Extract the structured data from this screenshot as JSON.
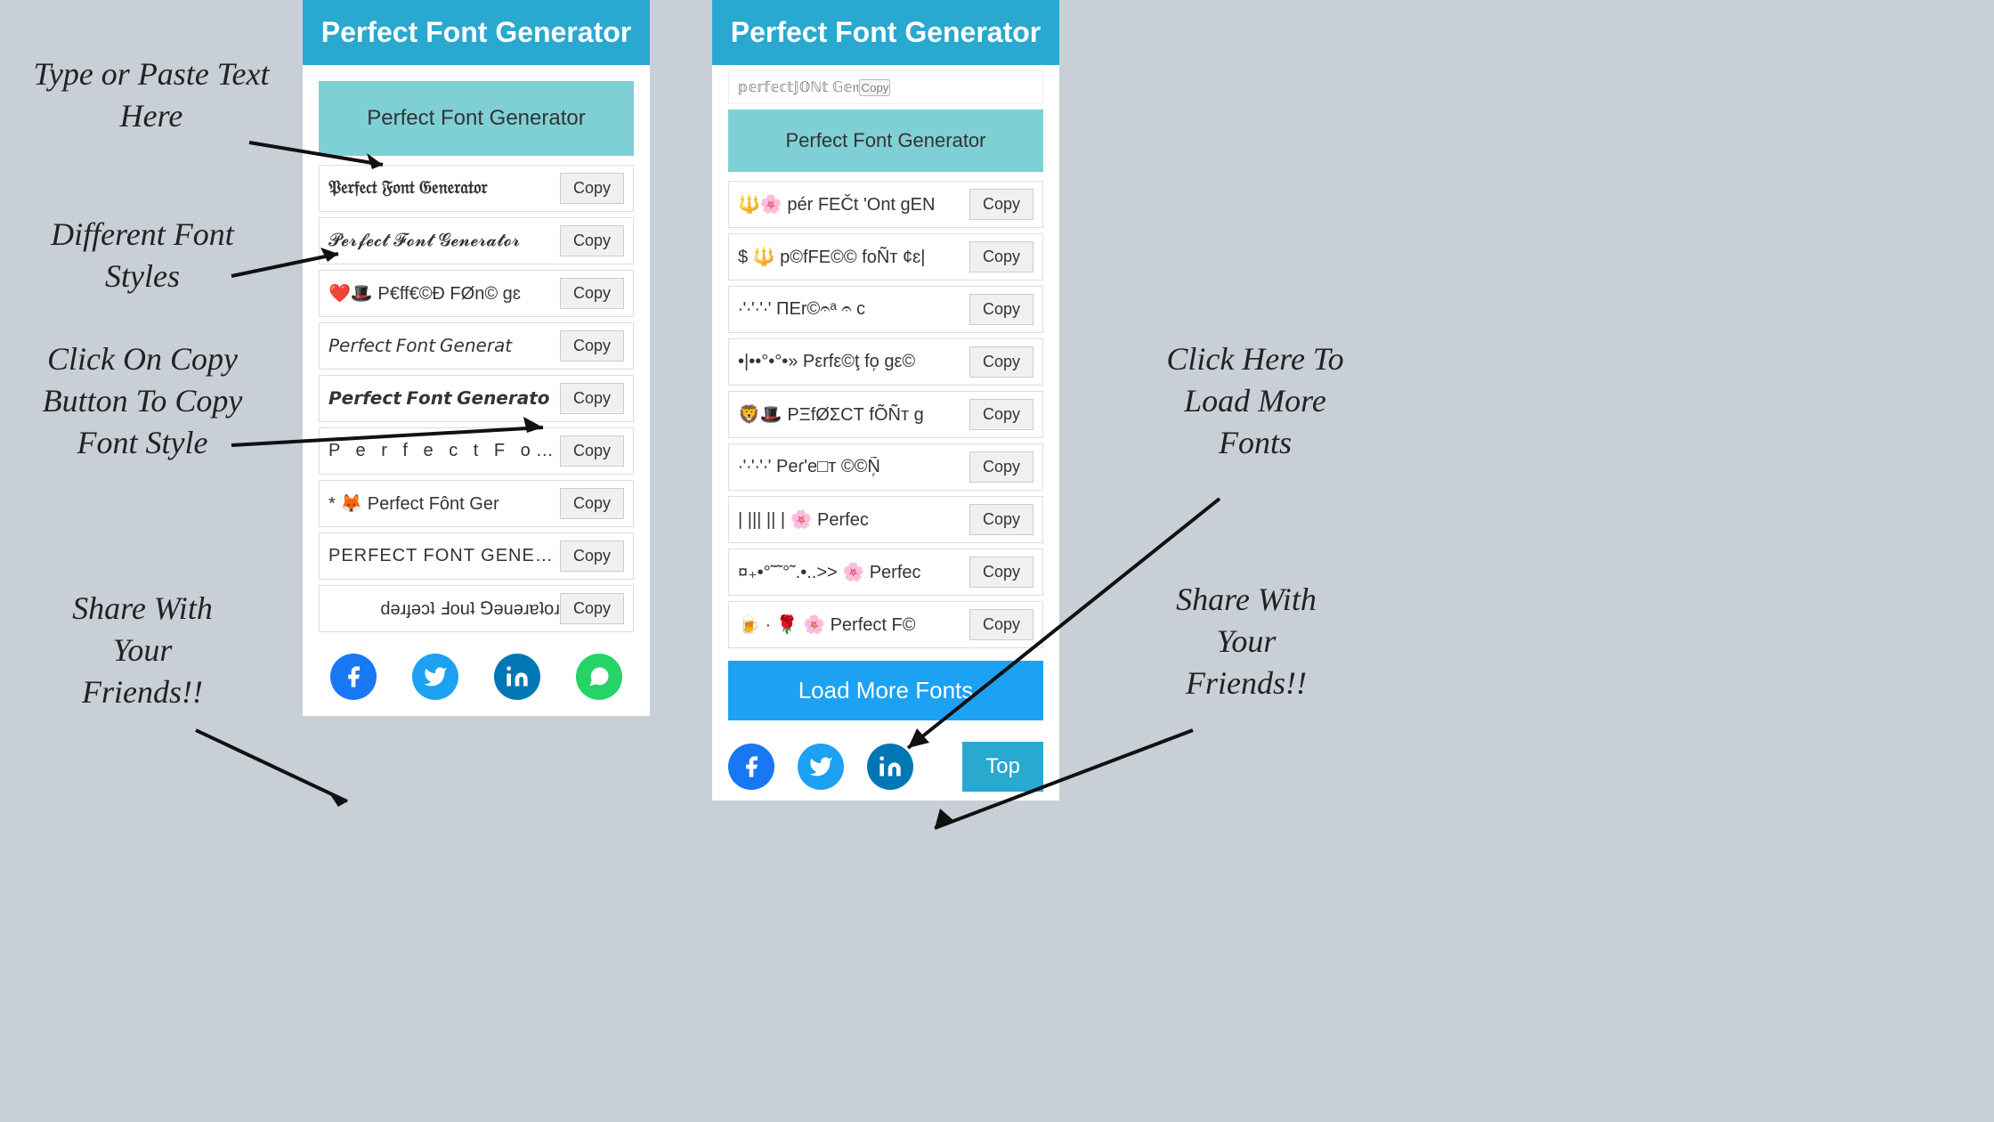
{
  "app": {
    "title": "Perfect Font Generator",
    "input_placeholder": "Perfect Font Generator",
    "input_value": "Perfect Font Generator"
  },
  "annotations": {
    "type_paste": "Type or Paste Text\nHere",
    "different_fonts": "Different Font\nStyles",
    "click_copy": "Click On Copy\nButton To Copy\nFont Style",
    "share_left": "Share With\nYour\nFriends!!",
    "click_load": "Click Here To\nLoad More\nFonts",
    "share_right": "Share With\nYour\nFriends!!"
  },
  "left_panel": {
    "header": "Perfect Font Generator",
    "input": "Perfect Font Generator",
    "fonts": [
      {
        "text": "𝔓𝔢𝔯𝔣𝔢𝔠𝔱 𝔉𝔬𝔫𝔱 𝔊𝔢𝔫𝔢𝔯𝔞𝔱𝔬𝔯",
        "copy": "Copy"
      },
      {
        "text": "𝓟𝓮𝓻𝓯𝓮𝓬𝓽 𝓕𝓸𝓷𝓽 𝓖𝓮𝓷𝓮𝓻𝓪𝓽𝓸𝓻",
        "copy": "Copy"
      },
      {
        "text": "❤️🎩 P€ff€©Ð FØn© gɛ",
        "copy": "Copy"
      },
      {
        "text": "𝘗𝘦𝘳𝘧𝘦𝘤𝘵 𝘍𝘰𝘯𝘵 𝘎𝘦𝘯𝘦𝘳𝘢𝘵",
        "copy": "Copy"
      },
      {
        "text": "𝙋𝙚𝙧𝙛𝙚𝙘𝙩 𝙁𝙤𝙣𝙩 𝙂𝙚𝙣𝙚𝙧𝙖𝙩𝙤",
        "copy": "Copy"
      },
      {
        "text": "P e r f e c t  F o n t",
        "copy": "Copy",
        "spaced": true
      },
      {
        "text": "* 🦊 Perfect Fônt Ger",
        "copy": "Copy"
      },
      {
        "text": "PERFECT FONT GENERATOR",
        "copy": "Copy",
        "caps": true
      },
      {
        "text": "ɹoʇɐɹǝuǝ⅁ ʇuoℲ ʇɔǝɟɹǝd",
        "copy": "Copy",
        "flipped": true
      }
    ],
    "social": [
      "fb",
      "tw",
      "li",
      "wa"
    ]
  },
  "right_panel": {
    "header": "Perfect Font Generator",
    "input": "Perfect Font Generator",
    "fonts": [
      {
        "text": "𝕡𝕖𝕣𝕗𝕖𝕔𝕥𝕁𝕆ℕ𝕥 𝔾𝕖𝔫",
        "copy": "Copy",
        "partial": true
      },
      {
        "text": "🔱🌸 pér FEČt 'Ont gEN",
        "copy": "Copy"
      },
      {
        "text": "$ 🔱 p©fFE©© foÑт ¢ ɛ|",
        "copy": "Copy"
      },
      {
        "text": "∙'∙'∙'∙'∙ ΠΕr©𝄐ᵃ 𝄐 c",
        "copy": "Copy"
      },
      {
        "text": "•|••°•°•» Pεrfε©ţ fo᷊ gε©",
        "copy": "Copy"
      },
      {
        "text": "🦁🎩 PΞfØΣCТ fÕÑт g",
        "copy": "Copy"
      },
      {
        "text": "∙'∙'∙'∙'∙ Pеɾ'е□т ©©Ñ᷊",
        "copy": "Copy"
      },
      {
        "text": "| ||| || | 🌸 Perfec",
        "copy": "Copy"
      },
      {
        "text": "¤₊•°˜˜°˜.•..>>  🌸 Perfec",
        "copy": "Copy"
      },
      {
        "text": "🍺 · 🌹 🌸 Perfect F©",
        "copy": "Copy"
      }
    ],
    "load_more": "Load More Fonts",
    "top_btn": "Top",
    "social": [
      "fb",
      "tw",
      "li"
    ]
  },
  "social_icons": {
    "fb": "f",
    "tw": "🐦",
    "li": "in",
    "wa": "📱"
  },
  "colors": {
    "header_bg": "#29a8d0",
    "input_bg": "#7fd0d4",
    "load_more_bg": "#1da1f2",
    "top_btn_bg": "#29a8d0",
    "bg": "#c8cfd6"
  }
}
